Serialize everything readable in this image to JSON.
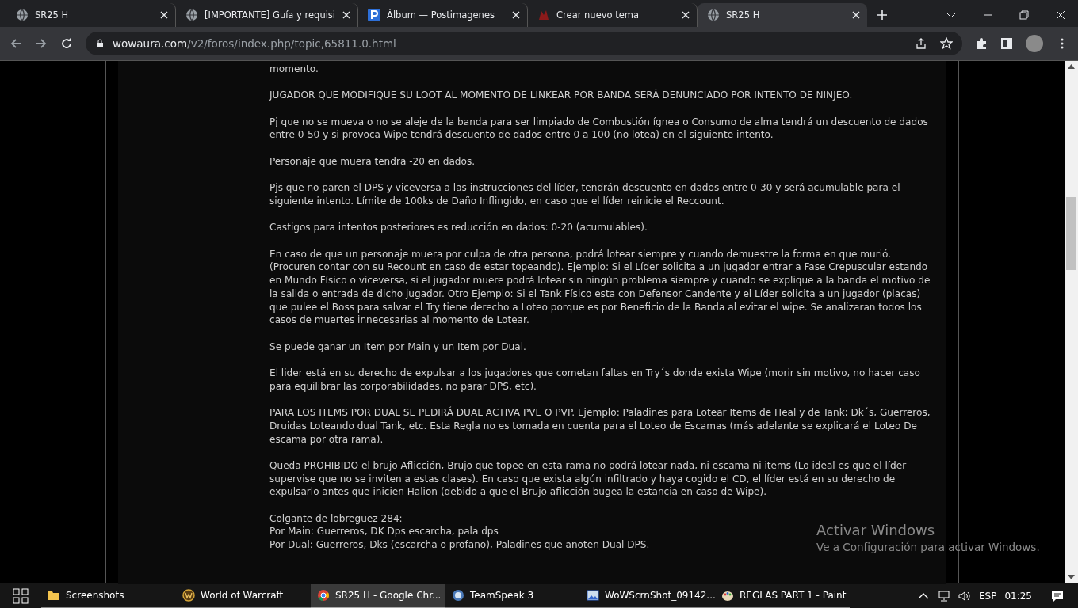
{
  "tabs": [
    {
      "title": "SR25 H",
      "selected": false
    },
    {
      "title": "[IMPORTANTE] Guía y requisi",
      "selected": false
    },
    {
      "title": "Álbum — Postimagenes",
      "selected": false
    },
    {
      "title": "Crear nuevo tema",
      "selected": false
    },
    {
      "title": "SR25 H",
      "selected": true
    }
  ],
  "address": {
    "domain": "wowaura.com",
    "path": "/v2/foros/index.php/topic,65811.0.html"
  },
  "post": [
    {
      "lines": [
        "momento."
      ]
    },
    {
      "lines": [
        "JUGADOR QUE MODIFIQUE SU LOOT AL MOMENTO DE LINKEAR POR BANDA SERÁ DENUNCIADO POR INTENTO DE NINJEO."
      ]
    },
    {
      "lines": [
        "Pj que no se mueva o no se aleje de la banda para ser limpiado de Combustión ígnea o Consumo de alma tendrá un descuento de dados entre 0-50 y si provoca Wipe tendrá descuento de dados entre 0 a 100 (no lotea) en el siguiente intento."
      ]
    },
    {
      "lines": [
        "Personaje que muera tendra -20 en dados."
      ]
    },
    {
      "lines": [
        "Pjs que no paren el DPS y viceversa a las instrucciones del líder, tendrán descuento en dados entre 0-30 y será acumulable para el siguiente intento. Límite de 100ks de Daño Inflingido, en caso que el líder reinicie el Reccount."
      ]
    },
    {
      "lines": [
        "Castigos para intentos posteriores es reducción en dados: 0-20 (acumulables)."
      ]
    },
    {
      "lines": [
        "En caso de que un personaje muera por culpa de otra persona, podrá lotear siempre y cuando demuestre la forma en que murió. (Procuren contar con su Recount en caso de estar topeando). Ejemplo: Si el Líder solicita a un jugador entrar a Fase Crepuscular estando en Mundo Físico o viceversa, si el jugador muere podrá lotear sin ningún problema siempre y cuando se explique a la banda el motivo de la salida o entrada de dicho jugador. Otro Ejemplo: Si el Tank Físico esta con Defensor Candente y el Líder solicita a un jugador (placas) que pulee el Boss para salvar el Try tiene derecho a Loteo porque es por Beneficio de la Banda al evitar el wipe. Se analizaran todos los casos de muertes innecesarias al momento de Lotear."
      ]
    },
    {
      "lines": [
        "Se puede ganar un Item por Main y un Item por Dual."
      ]
    },
    {
      "lines": [
        "El lider está en su derecho de expulsar a los jugadores que cometan faltas en Try´s donde exista Wipe (morir sin motivo, no hacer caso para equilibrar las corporabilidades, no parar DPS, etc)."
      ]
    },
    {
      "lines": [
        "PARA LOS ITEMS POR DUAL SE PEDIRÁ DUAL ACTIVA PVE O PVP. Ejemplo: Paladines para Lotear Items de Heal y de Tank; Dk´s, Guerreros, Druidas Loteando dual Tank, etc. Esta Regla no es tomada en cuenta para el Loteo de Escamas (más adelante se explicará el Loteo De escama por otra rama)."
      ]
    },
    {
      "lines": [
        "Queda PROHIBIDO el brujo Aflicción, Brujo que topee en esta rama no podrá lotear nada, ni escama ni items (Lo ideal es que el líder supervise que no se inviten a estas clases). En caso que exista algún infiltrado y haya cogido el CD, el líder está en su derecho de expulsarlo antes que inicien Halion (debido a que el Brujo aflicción bugea la estancia en caso de Wipe)."
      ]
    },
    {
      "lines": [
        "Colgante de lobreguez 284:",
        "Por Main: Guerreros, DK Dps escarcha, pala dps",
        "Por Dual: Guerreros, Dks (escarcha o profano), Paladines que anoten Dual DPS."
      ]
    }
  ],
  "activation": {
    "title": "Activar Windows",
    "subtitle": "Ve a Configuración para activar Windows."
  },
  "taskbar": {
    "items": [
      {
        "label": "Screenshots",
        "selected": false
      },
      {
        "label": "World of Warcraft",
        "selected": false
      },
      {
        "label": "SR25 H - Google Chr...",
        "selected": true
      },
      {
        "label": "TeamSpeak 3",
        "selected": false
      },
      {
        "label": "WoWScrnShot_09142...",
        "selected": false
      },
      {
        "label": "REGLAS PART 1 - Paint",
        "selected": false
      }
    ],
    "language": "ESP",
    "time": "01:25"
  }
}
